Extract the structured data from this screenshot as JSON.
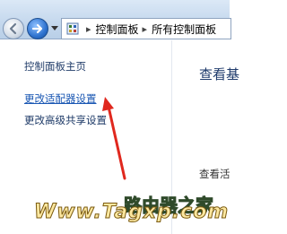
{
  "address_bar": {
    "crumbs": [
      "控制面板",
      "所有控制面板"
    ],
    "separator": "▸"
  },
  "sidebar": {
    "items": [
      {
        "label": "控制面板主页"
      },
      {
        "label": "更改适配器设置"
      },
      {
        "label": "更改高级共享设置"
      }
    ]
  },
  "main": {
    "heading": "查看基",
    "partial_text": "查看活"
  },
  "watermark": {
    "brand": "路由器之家",
    "url": "Www.Tagxp.com"
  },
  "colors": {
    "arrow": "#e0281e",
    "link": "#1a57b3"
  }
}
